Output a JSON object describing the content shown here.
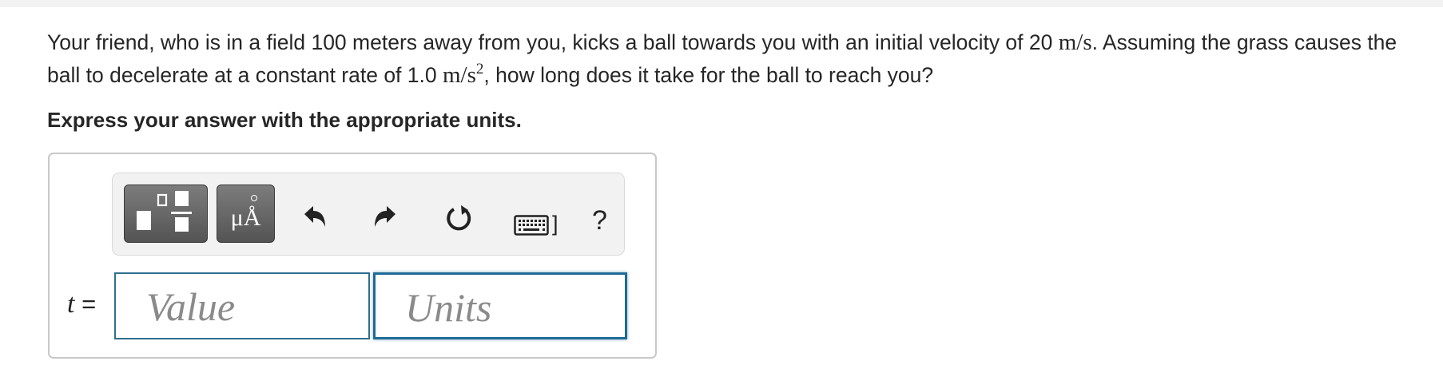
{
  "question": {
    "part1": "Your friend, who is in a field 100 meters away from you, kicks a ball towards you with an initial velocity of 20 ",
    "unit1": "m/s",
    "part2": ". Assuming the grass causes the ball to decelerate at a constant rate of 1.0 ",
    "unit2_base": "m/s",
    "unit2_exp": "2",
    "part3": ", how long does it take for the ball to reach you?"
  },
  "instruction": "Express your answer with the appropriate units.",
  "toolbar": {
    "buttons": [
      {
        "name": "templates",
        "icon": "fraction-template-icon"
      },
      {
        "name": "symbols",
        "icon": "units-symbol-icon",
        "label": "μÅ"
      },
      {
        "name": "undo",
        "icon": "undo-icon"
      },
      {
        "name": "redo",
        "icon": "redo-icon"
      },
      {
        "name": "reset",
        "icon": "reset-icon"
      },
      {
        "name": "keyboard",
        "icon": "keyboard-shortcuts-icon",
        "label": "]"
      },
      {
        "name": "help",
        "icon": "help-icon",
        "label": "?"
      }
    ]
  },
  "answer": {
    "variable": "t",
    "equals": "=",
    "value_placeholder": "Value",
    "units_placeholder": "Units",
    "value": "",
    "units": ""
  }
}
